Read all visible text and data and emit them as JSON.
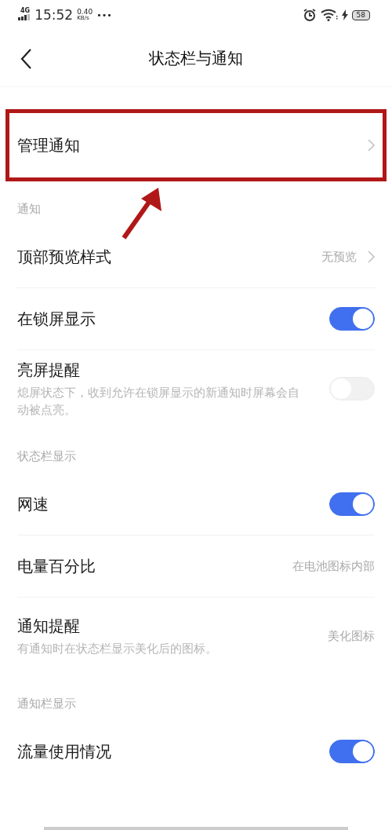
{
  "status_bar": {
    "network": "4G",
    "time": "15:52",
    "speed": "0.40",
    "speed_unit": "KB/s",
    "more": "•••",
    "battery": "58"
  },
  "header": {
    "title": "状态栏与通知"
  },
  "groups": [
    {
      "items": [
        {
          "kind": "link",
          "label": "管理通知",
          "highlighted": true
        }
      ]
    },
    {
      "header": "通知",
      "items": [
        {
          "kind": "link",
          "label": "顶部预览样式",
          "value": "无预览"
        },
        {
          "kind": "toggle",
          "label": "在锁屏显示",
          "on": true
        },
        {
          "kind": "toggle",
          "label": "亮屏提醒",
          "description": "熄屏状态下，收到允许在锁屏显示的新通知时屏幕会自动被点亮。",
          "on": false
        }
      ]
    },
    {
      "header": "状态栏显示",
      "items": [
        {
          "kind": "toggle",
          "label": "网速",
          "on": true
        },
        {
          "kind": "value",
          "label": "电量百分比",
          "value": "在电池图标内部"
        },
        {
          "kind": "value",
          "label": "通知提醒",
          "description": "有通知时在状态栏显示美化后的图标。",
          "value": "美化图标"
        }
      ]
    },
    {
      "header": "通知栏显示",
      "items": [
        {
          "kind": "toggle",
          "label": "流量使用情况",
          "on": true
        }
      ]
    }
  ]
}
